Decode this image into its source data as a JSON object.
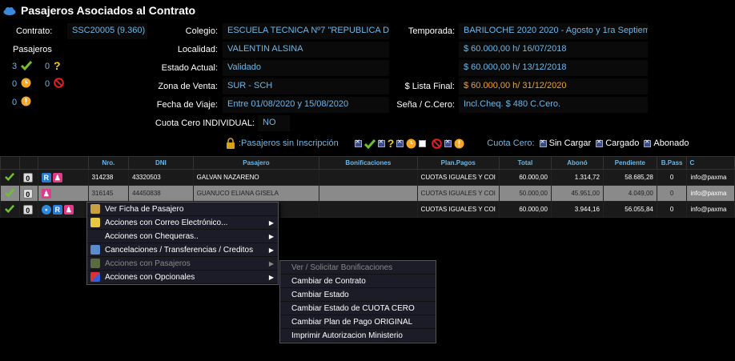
{
  "title": "Pasajeros Asociados al Contrato",
  "left": {
    "contrato_label": "Contrato:",
    "contrato_value": "SSC20005 (9.360)",
    "pasajeros_label": "Pasajeros",
    "count_ok": "3",
    "count_question": "0",
    "count_clock": "0",
    "count_block": "0",
    "count_warning": "0"
  },
  "mid": {
    "colegio_label": "Colegio:",
    "colegio_value": "ESCUELA TECNICA Nº7 \"REPUBLICA DE F",
    "localidad_label": "Localidad:",
    "localidad_value": "VALENTIN ALSINA",
    "estado_label": "Estado Actual:",
    "estado_value": "Validado",
    "zona_label": "Zona de Venta:",
    "zona_value": "SUR - SCH",
    "fecha_label": "Fecha de Viaje:",
    "fecha_value": "Entre 01/08/2020 y 15/08/2020",
    "cuota_label": "Cuota Cero INDIVIDUAL:",
    "cuota_value": "NO"
  },
  "right": {
    "temporada_label": "Temporada:",
    "temporada_value": "BARILOCHE 2020 2020 - Agosto y 1ra Septiem",
    "price1": "$ 60.000,00 h/ 16/07/2018",
    "price2": "$ 60.000,00 h/ 13/12/2018",
    "lista_label": "$ Lista Final:",
    "lista_value": "$ 60.000,00 h/ 31/12/2020",
    "sena_label": "Seña / C.Cero:",
    "sena_value": "Incl.Cheq. $ 480 C.Cero."
  },
  "legend": {
    "sin_inscripcion": ":Pasajeros sin Inscripción",
    "cuota_cero": "Cuota Cero:",
    "sin_cargar": "Sin Cargar",
    "cargado": "Cargado",
    "abonado": "Abonado"
  },
  "table": {
    "headers": [
      "Nro.",
      "DNI",
      "Pasajero",
      "Bonificaciones",
      "Plan.Pagos",
      "Total",
      "Abonó",
      "Pendiente",
      "B.Pass",
      "C"
    ],
    "rows": [
      {
        "nro": "314238",
        "dni": "43320503",
        "pasajero": "GALVAN NAZARENO",
        "bonif": "",
        "plan": "CUOTAS IGUALES Y COI",
        "total": "60.000,00",
        "abono": "1.314,72",
        "pendiente": "58.685,28",
        "bpass": "0",
        "email": "info@paxma"
      },
      {
        "nro": "316145",
        "dni": "44450838",
        "pasajero": "GUANUCO ELIANA GISELA",
        "bonif": "",
        "plan": "CUOTAS IGUALES Y COI",
        "total": "50.000,00",
        "abono": "45.951,00",
        "pendiente": "4.049,00",
        "bpass": "0",
        "email": "info@paxma"
      },
      {
        "nro": "",
        "dni": "",
        "pasajero": "",
        "bonif": "",
        "plan": "CUOTAS IGUALES Y COI",
        "total": "60.000,00",
        "abono": "3.944,16",
        "pendiente": "56.055,84",
        "bpass": "0",
        "email": "info@paxma"
      }
    ]
  },
  "context_menu": {
    "items": [
      "Ver Ficha de Pasajero",
      "Acciones con Correo Electrónico...",
      "Acciones con Chequeras..",
      "Cancelaciones / Transferencias / Creditos",
      "Acciones con Pasajeros",
      "Acciones con Opcionales"
    ]
  },
  "submenu": {
    "items": [
      "Ver / Solicitar Bonificaciones",
      "Cambiar de Contrato",
      "Cambiar Estado",
      "Cambiar Estado de CUOTA CERO",
      "Cambiar Plan de Pago ORIGINAL",
      "Imprimir Autorizacion Ministerio"
    ]
  },
  "colors": {
    "accent": "#6ab7e8",
    "orange": "#f0a030",
    "ok": "#6ec02e"
  }
}
